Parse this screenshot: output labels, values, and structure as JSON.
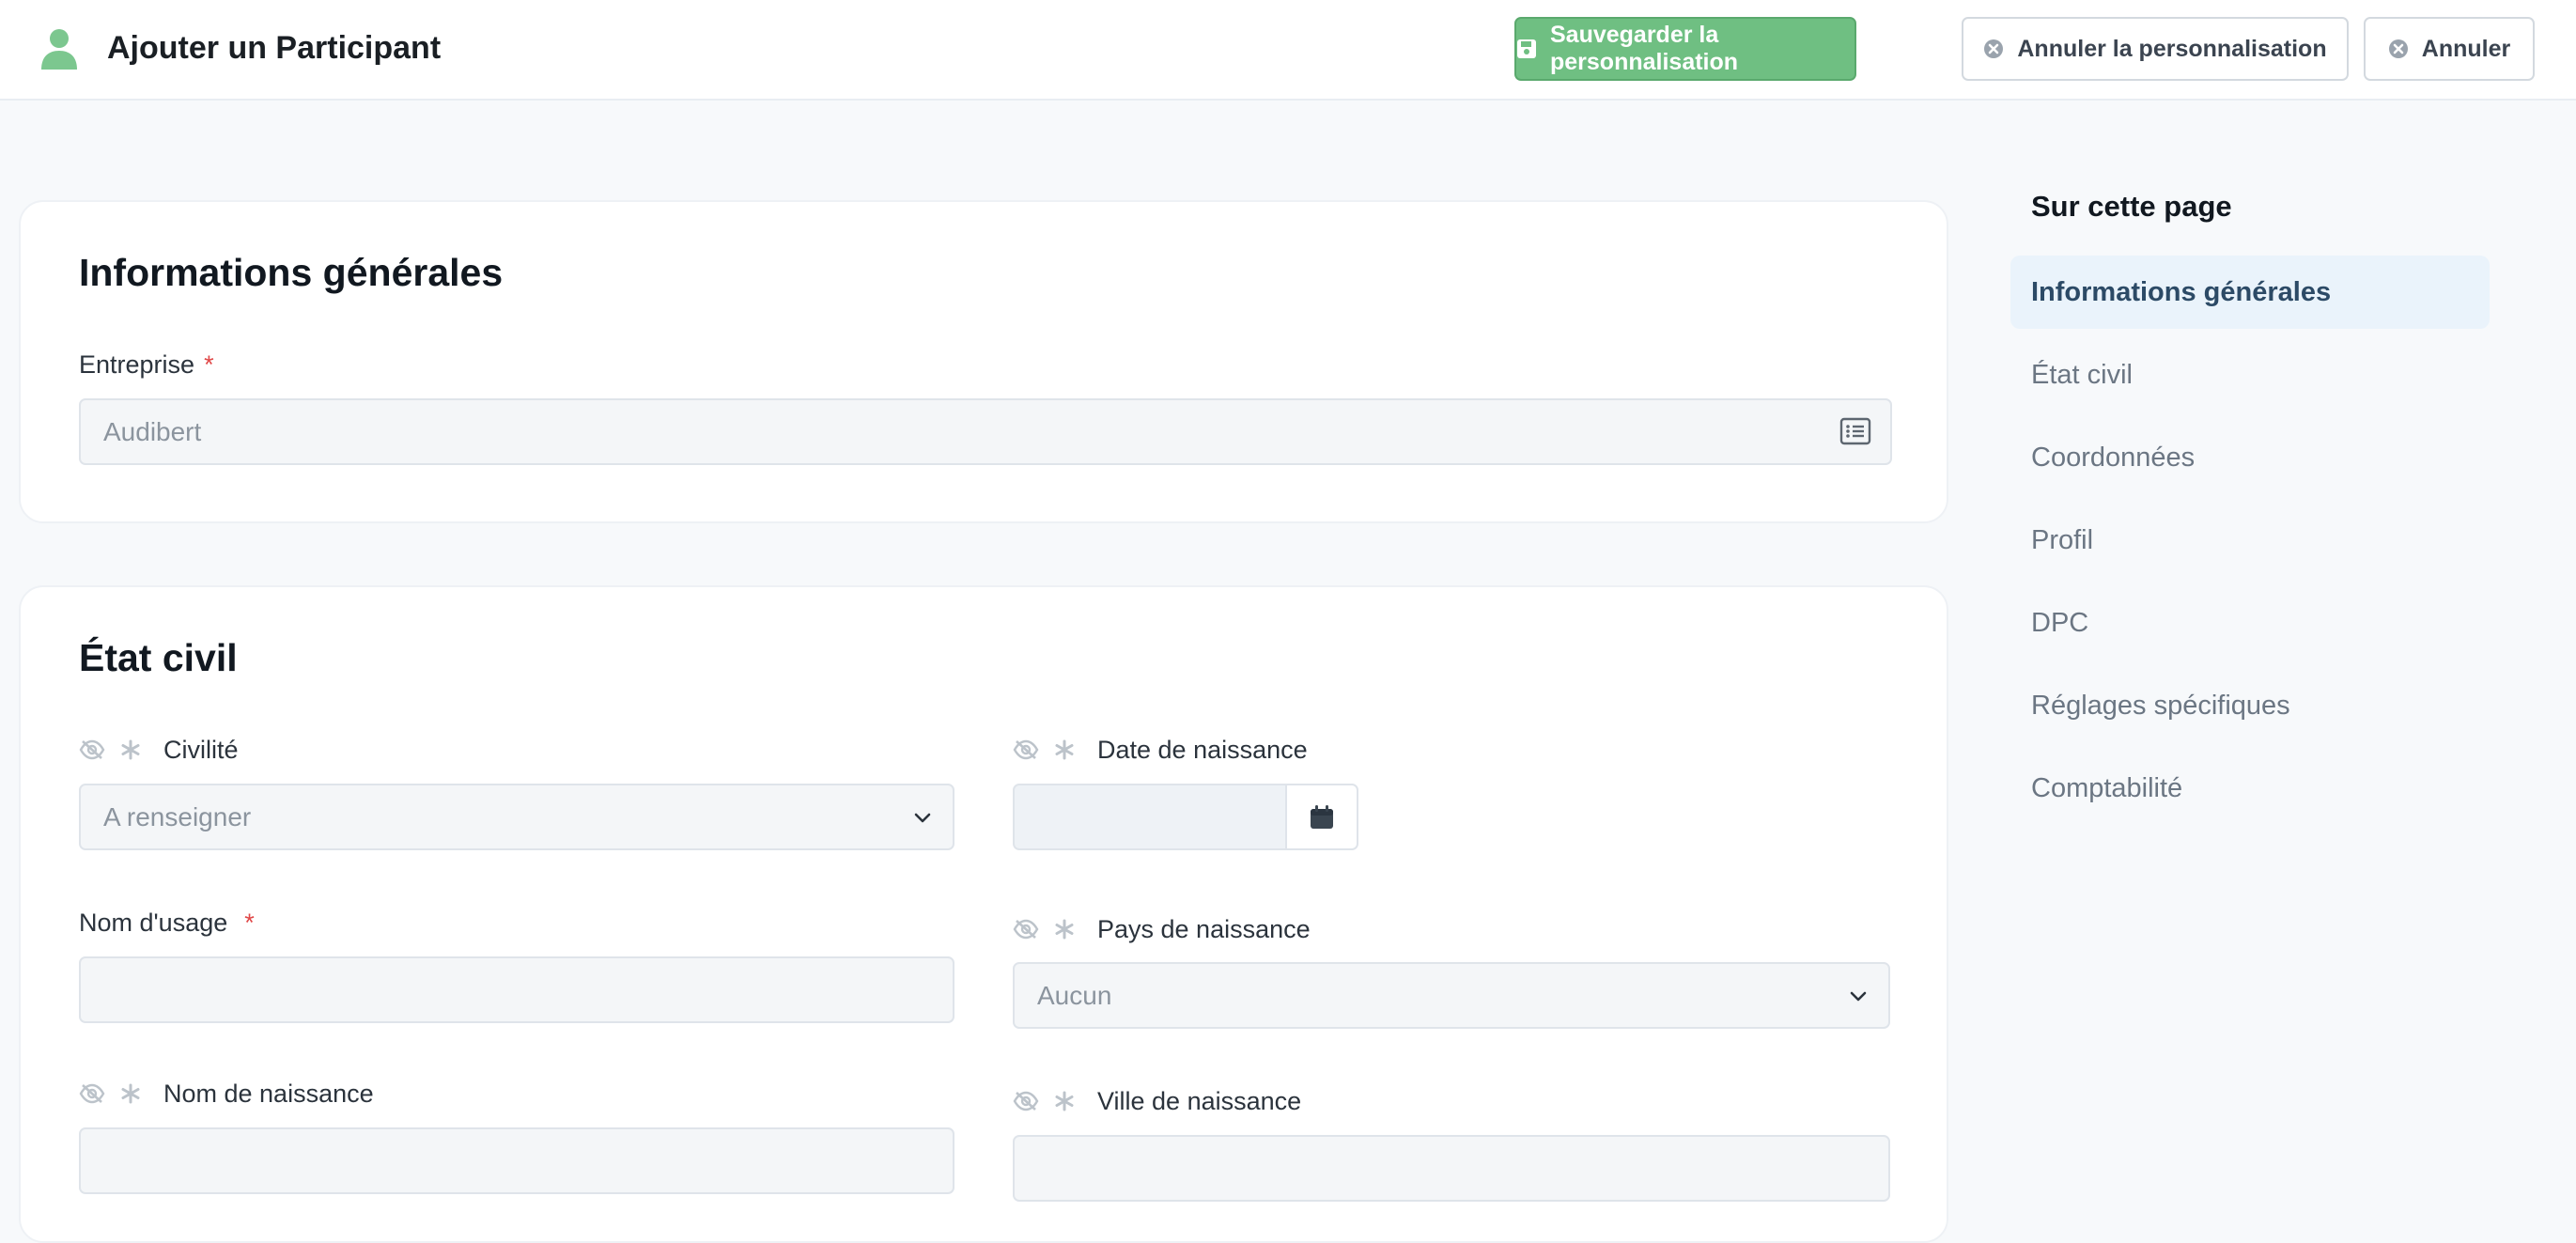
{
  "header": {
    "title": "Ajouter un Participant",
    "icon": "user-icon",
    "accent": "#6fbf82",
    "buttons": {
      "save": "Sauvegarder la personnalisation",
      "reset": "Annuler la personnalisation",
      "cancel": "Annuler"
    }
  },
  "general": {
    "title": "Informations générales",
    "entreprise": {
      "label": "Entreprise",
      "required": "*",
      "value": "Audibert"
    }
  },
  "civil": {
    "title": "État civil",
    "civilite": {
      "label": "Civilité",
      "value": "A renseigner"
    },
    "date_naissance": {
      "label": "Date de naissance",
      "value": ""
    },
    "nom_usage": {
      "label": "Nom d'usage",
      "required": "*",
      "value": ""
    },
    "pays_naissance": {
      "label": "Pays de naissance",
      "value": "Aucun"
    },
    "nom_naissance": {
      "label": "Nom de naissance",
      "value": ""
    },
    "ville_naissance": {
      "label": "Ville de naissance",
      "value": ""
    }
  },
  "toc": {
    "title": "Sur cette page",
    "items": [
      {
        "label": "Informations générales",
        "active": true
      },
      {
        "label": "État civil"
      },
      {
        "label": "Coordonnées"
      },
      {
        "label": "Profil"
      },
      {
        "label": "DPC"
      },
      {
        "label": "Réglages spécifiques"
      },
      {
        "label": "Comptabilité"
      }
    ]
  }
}
